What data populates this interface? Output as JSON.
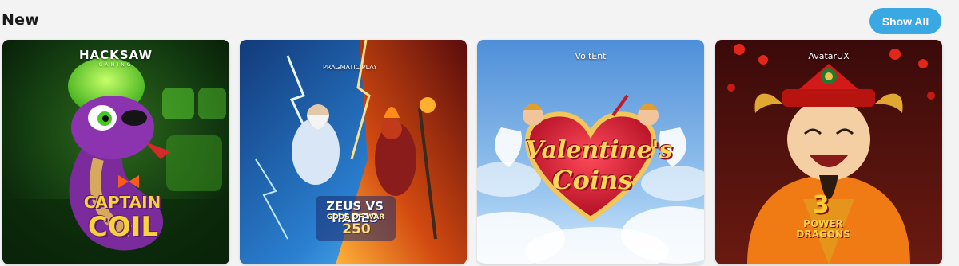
{
  "section": {
    "title": "New",
    "show_all_label": "Show All"
  },
  "accent_color": "#3aa9e3",
  "games": [
    {
      "provider": "HACKSAW",
      "provider_sub": "GAMING",
      "title_line1": "CAPTAIN",
      "title_line2": "COIL",
      "icon": "purple-snake-image"
    },
    {
      "provider": "PRAGMATIC PLAY",
      "title_line1": "ZEUS VS HADES",
      "title_line2": "GODS OF WAR",
      "title_line3": "250",
      "icon": "zeus-vs-hades-image"
    },
    {
      "provider": "VoltEnt",
      "title_line1": "Valentine's",
      "title_line2": "Coins",
      "icon": "heart-cupids-image"
    },
    {
      "provider": "AvatarUX",
      "title_line1": "3",
      "title_line2": "POWER",
      "title_line3": "DRAGONS",
      "icon": "fortune-god-image"
    }
  ]
}
